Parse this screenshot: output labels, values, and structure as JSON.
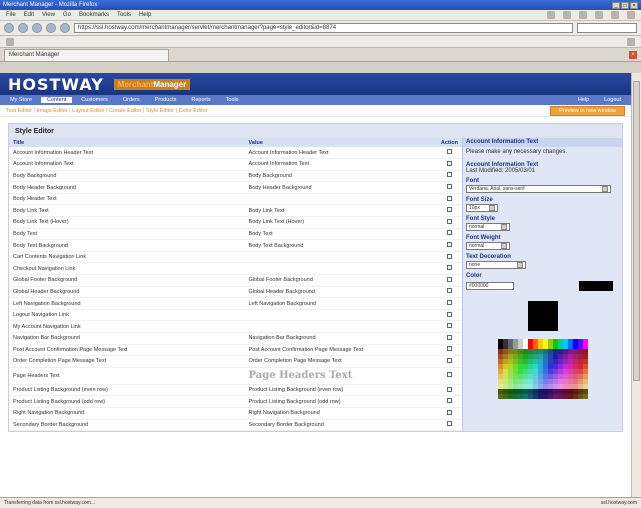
{
  "window": {
    "title": "Merchant Manager - Mozilla Firefox"
  },
  "menubar": {
    "items": [
      "File",
      "Edit",
      "View",
      "Go",
      "Bookmarks",
      "Tools",
      "Help"
    ]
  },
  "address": {
    "url": "https://ssl.hostway.com/merchantmanager/servlet/merchantmanager?page=style_editor&id=8874"
  },
  "browser_tab": {
    "label": "Merchant Manager"
  },
  "brand": {
    "logo": "HOSTWAY",
    "product_a": "Merchant",
    "product_b": "Manager"
  },
  "nav": {
    "tabs": [
      "My Store",
      "Content",
      "Customers",
      "Orders",
      "Products",
      "Reports",
      "Tools"
    ],
    "right": [
      "Help",
      "Logout"
    ]
  },
  "breadcrumbs": {
    "text": "Text Editor | Image Editor | Layout Editor | Create Editor | Style Editor | Color Editor",
    "preview": "Preview in new window"
  },
  "panel": {
    "title": "Style Editor"
  },
  "table": {
    "headers": [
      "Title",
      "Value",
      "Action"
    ],
    "rows": [
      [
        "Account Information Header Text",
        "Account Information Header Text"
      ],
      [
        "Account Information Text",
        "Account Information Text"
      ],
      [
        "Body Background",
        "Body Background"
      ],
      [
        "Body Header Background",
        "Body Header Background"
      ],
      [
        "Body Header Text",
        ""
      ],
      [
        "Body Link Text",
        "Body Link Text"
      ],
      [
        "Body Link Text (Hover)",
        "Body Link Text (Hover)"
      ],
      [
        "Body Text",
        "Body Text"
      ],
      [
        "Body Text Background",
        "Body Text Background"
      ],
      [
        "Cart Contents Navigation Link",
        ""
      ],
      [
        "Checkout Navigation Link",
        ""
      ],
      [
        "Global Footer Background",
        "Global Footer Background"
      ],
      [
        "Global Header Background",
        "Global Header Background"
      ],
      [
        "Left Navigation Background",
        "Left Navigation Background"
      ],
      [
        "Logout Navigation Link",
        ""
      ],
      [
        "My Account Navigation Link",
        ""
      ],
      [
        "Navigation Bar Background",
        "Navigation Bar Background"
      ],
      [
        "Post Account Confirmation Page Message Text",
        "Post Account Confirmation Page Message Text"
      ],
      [
        "Order Completion Page Message Text",
        "Order Completion Page Message Text"
      ]
    ],
    "big_row": [
      "Page Headers Text",
      "Page Headers Text"
    ],
    "tail_rows": [
      [
        "Product Listing Background (even row)",
        "Product Listing Background (even row)"
      ],
      [
        "Product Listing Background (odd row)",
        "Product Listing Background (odd row)"
      ],
      [
        "Right Navigation Background",
        "Right Navigation Background"
      ],
      [
        "Secondary Border Background",
        "Secondary Border Background"
      ]
    ]
  },
  "side": {
    "header": "Account Information Text",
    "hint": "Please make any necessary changes.",
    "item_title": "Account Information Text",
    "last_modified": "Last Modified: 2005/03/01",
    "font_label": "Font",
    "font_value": "Verdana, Arial, sans-serif",
    "size_label": "Font Size",
    "size_value": "10px",
    "style_label": "Font Style",
    "style_value": "normal",
    "weight_label": "Font Weight",
    "weight_value": "normal",
    "decoration_label": "Text Decoration",
    "decoration_value": "none",
    "color_label": "Color",
    "color_value": "#000000"
  },
  "status": {
    "left": "Transferring data from ssl.hostway.com...",
    "right": "ssl.hostway.com"
  },
  "colors": {
    "brand": "#1a3380",
    "nav": "#5a78c8",
    "accent": "#f0a040",
    "side_bg": "#dfe6f6"
  }
}
